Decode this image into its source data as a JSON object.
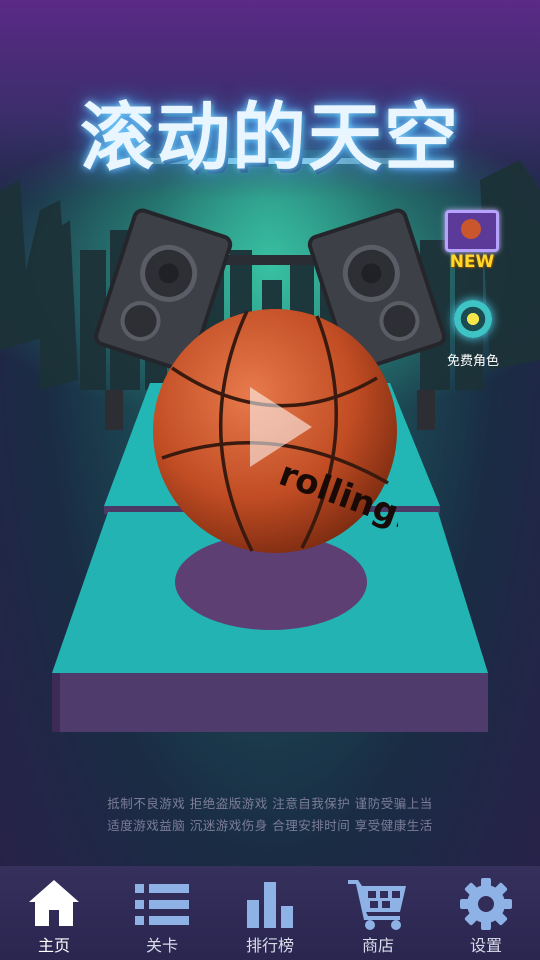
{
  "game": {
    "title": "滚动的天空"
  },
  "ball": {
    "brand_text": "rolling.sky"
  },
  "side_buttons": {
    "new_label": "NEW",
    "free_role_label": "免费角色"
  },
  "notice": {
    "line1": "抵制不良游戏  拒绝盗版游戏  注意自我保护  谨防受骗上当",
    "line2": "适度游戏益脑  沉迷游戏伤身  合理安排时间  享受健康生活"
  },
  "nav": {
    "items": [
      {
        "label": "主页",
        "icon": "home-icon",
        "active": true
      },
      {
        "label": "关卡",
        "icon": "list-icon",
        "active": false
      },
      {
        "label": "排行榜",
        "icon": "bar-chart-icon",
        "active": false
      },
      {
        "label": "商店",
        "icon": "cart-icon",
        "active": false
      },
      {
        "label": "设置",
        "icon": "gear-icon",
        "active": false
      }
    ]
  },
  "colors": {
    "platform": "#1fb4b3",
    "platform_side": "#4e3a6a",
    "ball": "#c9562c",
    "nav_bg": "#322c58",
    "nav_icon": "#8fb2e6",
    "home_icon": "#ffffff"
  }
}
